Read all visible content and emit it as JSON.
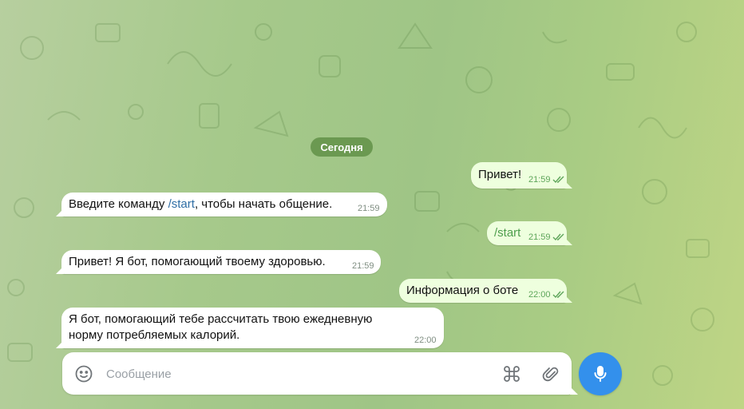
{
  "date_separator": "Сегодня",
  "messages": [
    {
      "direction": "out",
      "text": "Привет!",
      "time": "21:59",
      "read": true
    },
    {
      "direction": "in",
      "text_before": "Введите команду ",
      "command": "/start",
      "text_after": ", чтобы начать общение.",
      "time": "21:59"
    },
    {
      "direction": "out",
      "command": "/start",
      "time": "21:59",
      "read": true
    },
    {
      "direction": "in",
      "text": "Привет! Я бот, помогающий твоему здоровью.",
      "time": "21:59"
    },
    {
      "direction": "out",
      "text": "Информация о боте",
      "time": "22:00",
      "read": true
    },
    {
      "direction": "in",
      "line1": "Я бот, помогающий тебе рассчитать твою ежедневную",
      "line2": "норму потребляемых калорий.",
      "time": "22:00"
    }
  ],
  "composer": {
    "placeholder": "Сообщение",
    "value": "",
    "icons": [
      "emoji-icon",
      "command-icon",
      "attach-icon",
      "microphone-icon"
    ]
  },
  "colors": {
    "accent": "#3390ec",
    "outgoing_bubble": "#eeffde",
    "incoming_bubble": "#ffffff",
    "date_pill": "#629148",
    "read_check": "#5ea55a"
  }
}
